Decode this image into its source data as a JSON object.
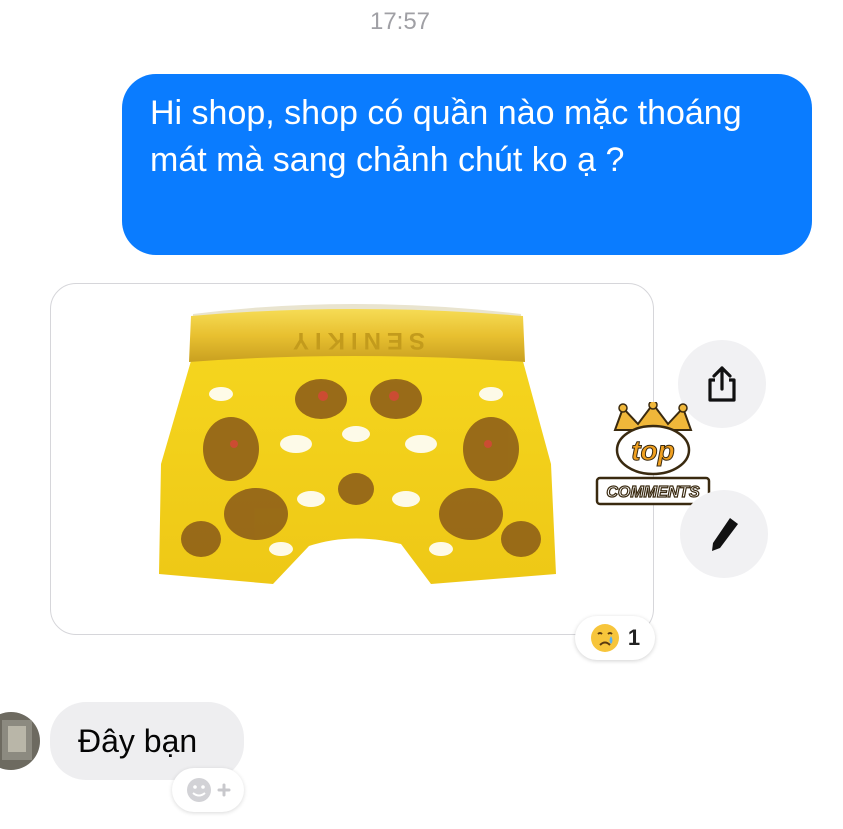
{
  "chat": {
    "timestamp": "17:57",
    "outgoing_message": "Hi shop, shop có quần nào mặc thoáng mát mà sang chảnh chút ko ạ ?",
    "image_message": {
      "waistband_text": "SENIKIY",
      "reaction": {
        "emoji_icon": "crying-face-emoji-icon",
        "count": "1"
      }
    },
    "incoming_message": "Đây bạn"
  },
  "actions": {
    "share_icon": "share-icon",
    "edit_icon": "pencil-icon",
    "add_reaction_icon": "add-reaction-icon"
  },
  "sticker": {
    "top_text": "top",
    "bottom_text": "COMMENTS"
  },
  "colors": {
    "outgoing_bubble": "#0a7cff",
    "incoming_bubble": "#eeeef0",
    "underwear_yellow": "#f2d21a",
    "waistband_gold": "#e8c030"
  }
}
